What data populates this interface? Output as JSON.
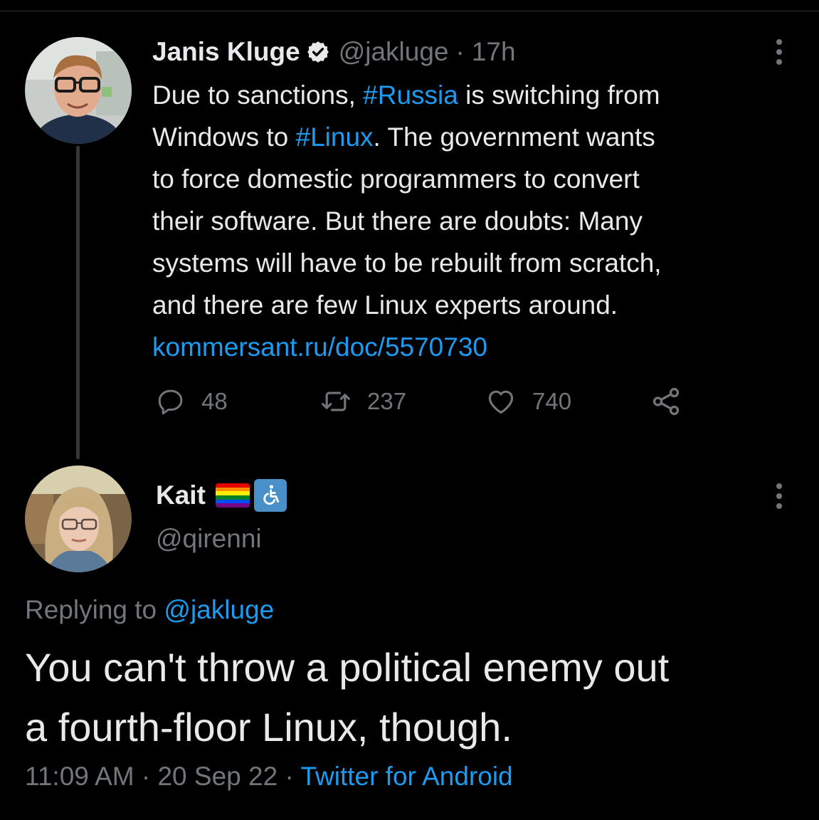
{
  "original_tweet": {
    "author_name": "Janis Kluge",
    "handle": "@jakluge",
    "separator": "·",
    "time": "17h",
    "verified": true,
    "text_segments": [
      {
        "t": "Due to sanctions, ",
        "kind": "text"
      },
      {
        "t": "#Russia",
        "kind": "hashtag"
      },
      {
        "t": " is switching from",
        "kind": "text"
      },
      {
        "t": "Windows to ",
        "kind": "text"
      },
      {
        "t": "#Linux",
        "kind": "hashtag"
      },
      {
        "t": ". The government wants",
        "kind": "text"
      },
      {
        "t": "to force domestic programmers to convert",
        "kind": "text"
      },
      {
        "t": "their software. But there are doubts: Many",
        "kind": "text"
      },
      {
        "t": "systems will have to be rebuilt from scratch,",
        "kind": "text"
      },
      {
        "t": "and there are few Linux experts around.",
        "kind": "text"
      },
      {
        "t": "kommersant.ru/doc/5570730",
        "kind": "link"
      }
    ],
    "reply_count": "48",
    "retweet_count": "237",
    "like_count": "740"
  },
  "reply_tweet": {
    "author_name": "Kait",
    "handle": "@qirenni",
    "replying_label": "Replying to",
    "replying_handle": "@jakluge",
    "text_line_1": "You can't throw a political enemy out",
    "text_line_2": "a fourth-floor Linux, though.",
    "time": "11:09 AM",
    "separator_1": "·",
    "date": "20 Sep 22",
    "separator_2": "·",
    "source": "Twitter for Android"
  },
  "icons": {
    "verified": "verified-badge-icon",
    "more": "more-options-icon",
    "reply": "reply-icon",
    "retweet": "retweet-icon",
    "like": "heart-icon",
    "share": "share-icon",
    "pride_flag": "rainbow-flag-emoji",
    "wheelchair": "manual-wheelchair-emoji"
  },
  "colors": {
    "background": "#000000",
    "text_primary": "#e7e9ea",
    "text_secondary": "#71767b",
    "accent_link": "#1d9bf0",
    "thread_line": "#333639"
  }
}
